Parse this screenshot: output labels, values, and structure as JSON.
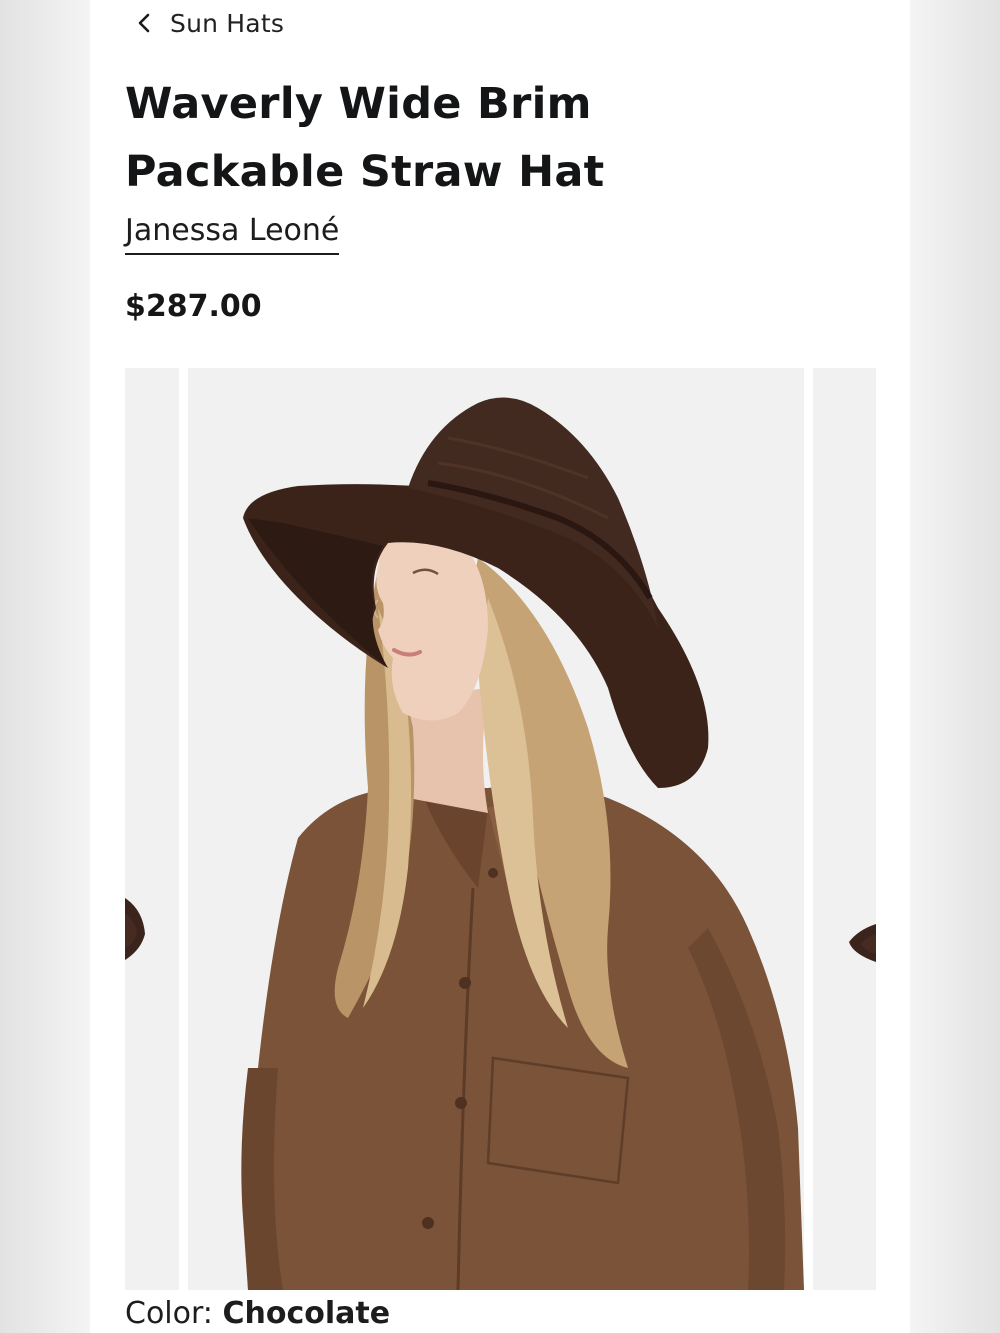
{
  "nav": {
    "back_label": "Sun Hats",
    "back_icon": "chevron-left-icon"
  },
  "product": {
    "title": "Waverly Wide Brim Packable Straw Hat",
    "brand": "Janessa Leoné",
    "price": "$287.00",
    "color_label": "Color:",
    "color_value": "Chocolate"
  },
  "gallery": {
    "images": [
      "previous-product-photo",
      "main-product-photo",
      "next-product-photo"
    ],
    "current_index": 2,
    "total_visible": 3
  },
  "colors": {
    "page_bg": "#ffffff",
    "image_bg": "#f1f1f1",
    "hat": "#3d241b",
    "shirt": "#7a5237",
    "hair": "#c9a77a"
  }
}
